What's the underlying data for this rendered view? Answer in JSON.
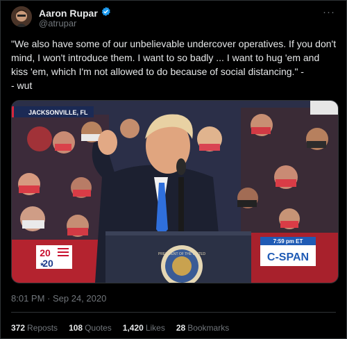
{
  "author": {
    "name": "Aaron Rupar",
    "handle": "@atrupar",
    "verified": true
  },
  "tweet_text": "\"We also have some of our unbelievable undercover operatives. If you don't mind, I won't introduce them. I want to so badly ... I want to hug 'em and kiss 'em, which I'm not allowed to do because of social distancing.\" -\n- wut",
  "media": {
    "location_tag": "JACKSONVILLE, FL",
    "time_tag": "7:59 pm ET",
    "network": "C-SPAN",
    "campaign_logo_top": "20",
    "campaign_logo_bottom": "20",
    "seal_text": "PRESIDENT OF THE UNITED"
  },
  "timestamp": "8:01 PM · Sep 24, 2020",
  "stats": [
    {
      "count": "372",
      "label": "Reposts"
    },
    {
      "count": "108",
      "label": "Quotes"
    },
    {
      "count": "1,420",
      "label": "Likes"
    },
    {
      "count": "28",
      "label": "Bookmarks"
    }
  ],
  "colors": {
    "verified_badge": "#1d9bf0",
    "cspan_blue": "#1f5bb5",
    "background": "#000000"
  }
}
